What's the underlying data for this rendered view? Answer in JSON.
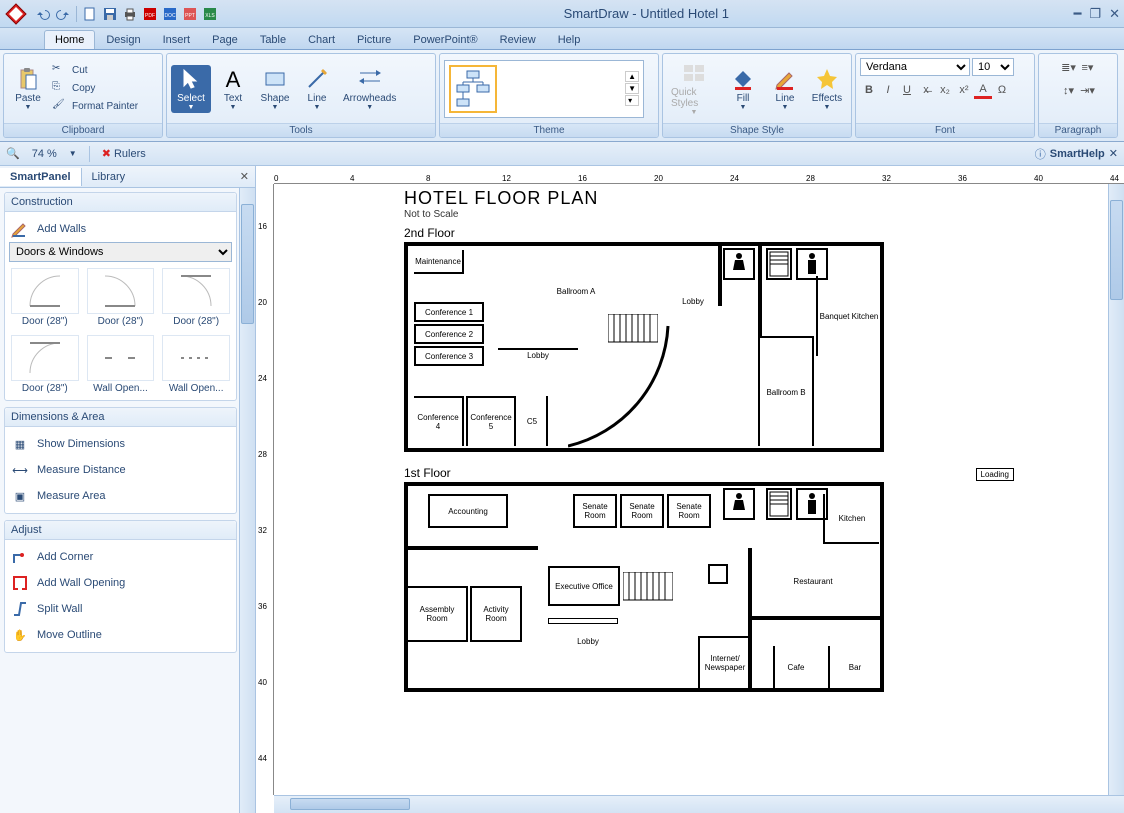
{
  "app": {
    "title": "SmartDraw - Untitled Hotel 1"
  },
  "menu": {
    "tabs": [
      "Home",
      "Design",
      "Insert",
      "Page",
      "Table",
      "Chart",
      "Picture",
      "PowerPoint®",
      "Review",
      "Help"
    ],
    "active": "Home"
  },
  "ribbon": {
    "clipboard": {
      "title": "Clipboard",
      "paste": "Paste",
      "cut": "Cut",
      "copy": "Copy",
      "format_painter": "Format Painter"
    },
    "tools": {
      "title": "Tools",
      "select": "Select",
      "text": "Text",
      "shape": "Shape",
      "line": "Line",
      "arrowheads": "Arrowheads"
    },
    "theme": {
      "title": "Theme"
    },
    "shape_style": {
      "title": "Shape Style",
      "quick_styles": "Quick Styles",
      "fill": "Fill",
      "line": "Line",
      "effects": "Effects"
    },
    "font": {
      "title": "Font",
      "family": "Verdana",
      "size": "10"
    },
    "paragraph": {
      "title": "Paragraph"
    }
  },
  "subbar": {
    "zoom": "74 %",
    "rulers": "Rulers",
    "smarthelp": "SmartHelp"
  },
  "leftpanel": {
    "tabs": [
      "SmartPanel",
      "Library"
    ],
    "active": "SmartPanel",
    "construction": {
      "title": "Construction",
      "add_walls": "Add Walls",
      "dropdown": "Doors & Windows",
      "shapes": [
        "Door (28\")",
        "Door (28\")",
        "Door (28\")",
        "Door (28\")",
        "Wall Open...",
        "Wall Open..."
      ]
    },
    "dimensions": {
      "title": "Dimensions & Area",
      "items": [
        "Show Dimensions",
        "Measure Distance",
        "Measure Area"
      ]
    },
    "adjust": {
      "title": "Adjust",
      "items": [
        "Add Corner",
        "Add Wall Opening",
        "Split Wall",
        "Move Outline"
      ]
    }
  },
  "document": {
    "title": "HOTEL FLOOR PLAN",
    "subtitle": "Not to Scale",
    "floor2": {
      "label": "2nd Floor",
      "rooms": {
        "maintenance": "Maintenance",
        "ballroom_a": "Ballroom A",
        "lobby_top": "Lobby",
        "conf1": "Conference 1",
        "conf2": "Conference 2",
        "conf3": "Conference 3",
        "conf4": "Conference 4",
        "conf5": "Conference 5",
        "c5": "C5",
        "lobby_mid": "Lobby",
        "ballroom_b": "Ballroom B",
        "banquet": "Banquet Kitchen"
      }
    },
    "floor1": {
      "label": "1st Floor",
      "loading": "Loading",
      "rooms": {
        "accounting": "Accounting",
        "senate1": "Senate Room",
        "senate2": "Senate Room",
        "senate3": "Senate Room",
        "kitchen": "Kitchen",
        "assembly": "Assembly Room",
        "activity": "Activity Room",
        "exec": "Executive Office",
        "lobby": "Lobby",
        "restaurant": "Restaurant",
        "internet": "Internet/ Newspaper",
        "cafe": "Cafe",
        "bar": "Bar"
      }
    }
  }
}
